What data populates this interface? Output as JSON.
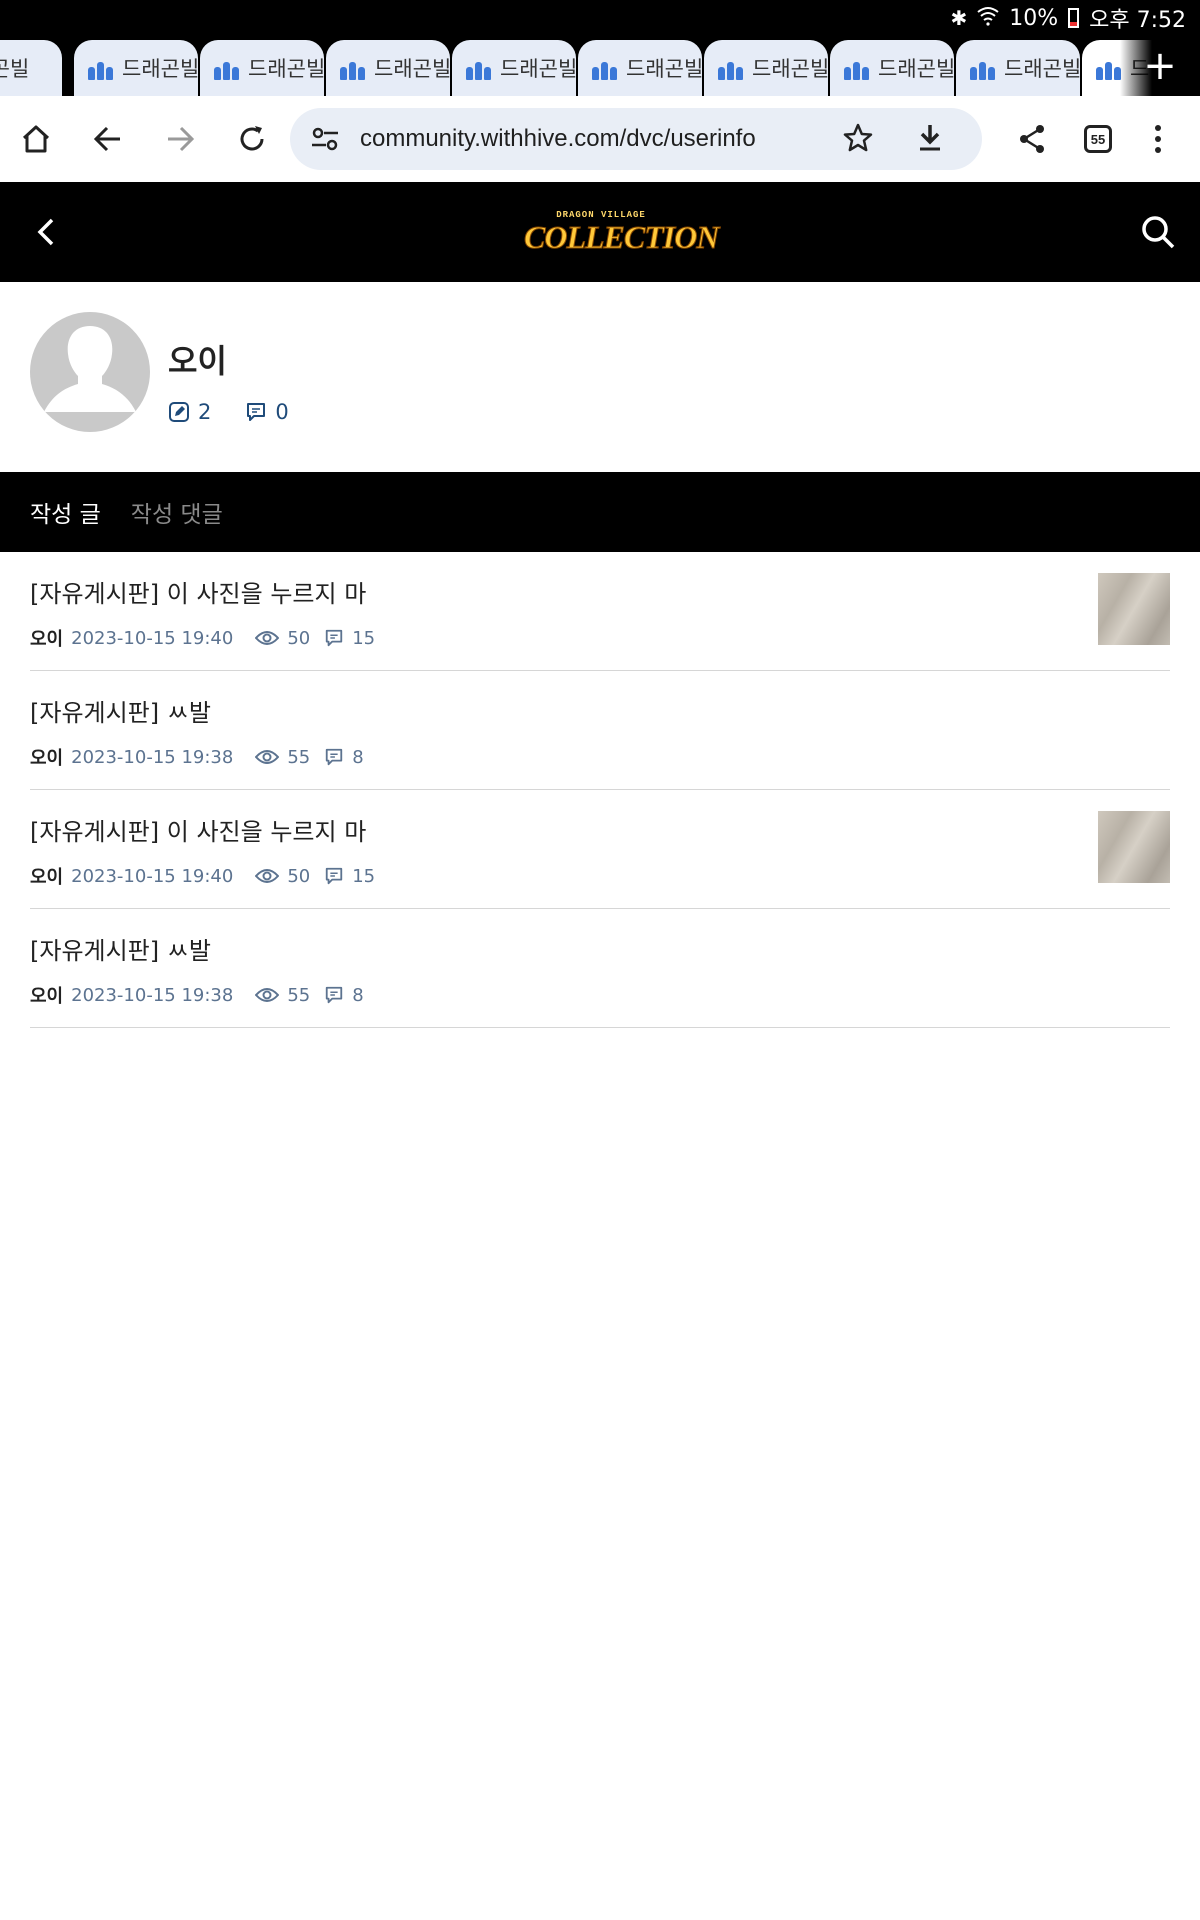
{
  "status_bar": {
    "battery": "10%",
    "time": "오후 7:52"
  },
  "tabs": {
    "first_partial": "드래곤빌",
    "items": [
      "드래곤빌",
      "드래곤빌",
      "드래곤빌",
      "드래곤빌",
      "드래곤빌",
      "드래곤빌",
      "드래곤빌",
      "드래곤빌",
      "드"
    ],
    "new_tab": "+"
  },
  "toolbar": {
    "url": "community.withhive.com/dvc/userinfo",
    "tab_count": "55"
  },
  "site_header": {
    "logo_small": "DRAGON VILLAGE",
    "logo_big": "COLLECTION"
  },
  "profile": {
    "name": "오이",
    "post_count": "2",
    "comment_count": "0"
  },
  "content_tabs": {
    "posts_label": "작성 글",
    "comments_label": "작성 댓글"
  },
  "posts": [
    {
      "title": "[자유게시판] 이 사진을 누르지 마",
      "author": "오이",
      "date": "2023-10-15 19:40",
      "views": "50",
      "comments": "15",
      "has_thumb": true
    },
    {
      "title": "[자유게시판] ㅆ발",
      "author": "오이",
      "date": "2023-10-15 19:38",
      "views": "55",
      "comments": "8",
      "has_thumb": false
    },
    {
      "title": "[자유게시판] 이 사진을 누르지 마",
      "author": "오이",
      "date": "2023-10-15 19:40",
      "views": "50",
      "comments": "15",
      "has_thumb": true
    },
    {
      "title": "[자유게시판] ㅆ발",
      "author": "오이",
      "date": "2023-10-15 19:38",
      "views": "55",
      "comments": "8",
      "has_thumb": false
    }
  ]
}
